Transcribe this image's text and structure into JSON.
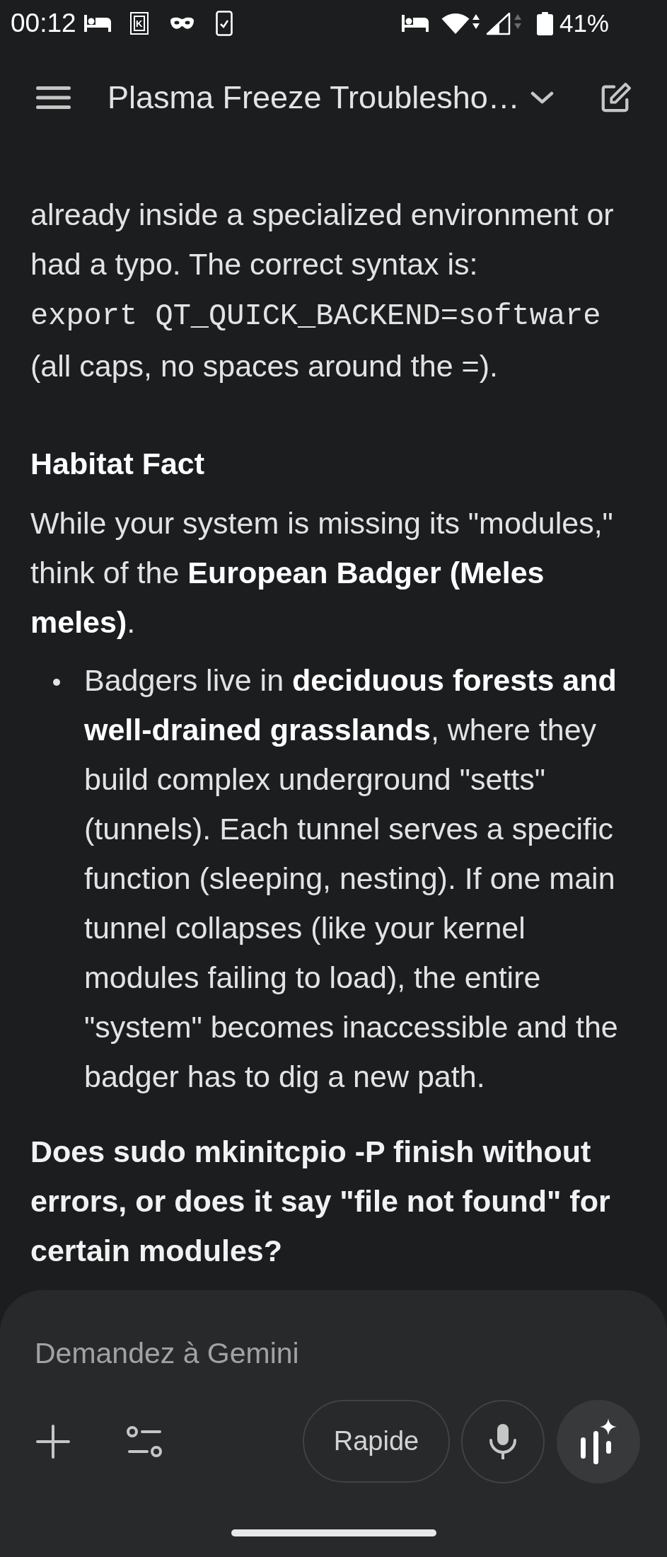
{
  "status_bar": {
    "time": "00:12",
    "app_badge": "K",
    "battery": "41%"
  },
  "header": {
    "title": "Plasma Freeze Troublesho…"
  },
  "message": {
    "blocks": [
      {
        "kind": "paragraph",
        "parts": [
          {
            "kind": "text",
            "text": "already inside a specialized environment or had a typo. The correct syntax is:"
          },
          {
            "kind": "code",
            "text": "export QT_QUICK_BACKEND=software"
          },
          {
            "kind": "text",
            "text": "(all caps, no spaces around the =)."
          }
        ]
      },
      {
        "kind": "heading",
        "text": "Habitat Fact"
      },
      {
        "kind": "paragraph",
        "parts": [
          {
            "kind": "text",
            "text": "While your system is missing its \"modules,\" think of the **European Badger (Meles meles)**."
          }
        ]
      },
      {
        "kind": "bullets",
        "items": [
          "Badgers live in **deciduous forests and well-drained grasslands**, where they build complex underground \"setts\" (tunnels). Each tunnel serves a specific function (sleeping, nesting). If one main tunnel collapses (like your kernel modules failing to load), the entire \"system\" becomes inaccessible and the badger has to dig a new path."
        ]
      },
      {
        "kind": "question",
        "text": "Does sudo mkinitcpio -P finish without errors, or does it say \"file not found\" for certain modules?"
      }
    ]
  },
  "composer": {
    "placeholder": "Demandez à Gemini",
    "mode_button": "Rapide"
  }
}
